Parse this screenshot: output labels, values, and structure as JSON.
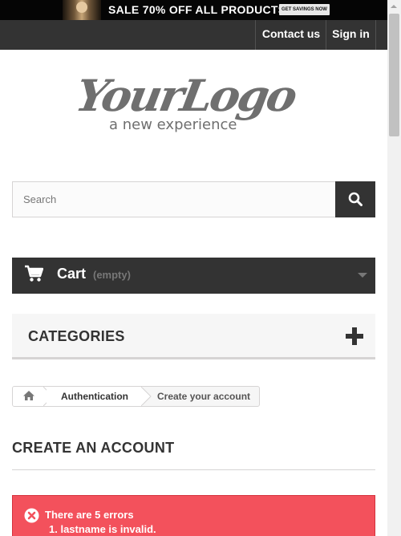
{
  "promo": {
    "text": "SALE 70% OFF ALL PRODUCTS",
    "button_label": "GET SAVINGS NOW"
  },
  "nav": {
    "contact_label": "Contact us",
    "signin_label": "Sign in"
  },
  "logo": {
    "wordmark": "YourLogo",
    "tagline": "a new experience"
  },
  "search": {
    "placeholder": "Search",
    "value": "",
    "button_icon": "search-icon"
  },
  "cart": {
    "label": "Cart",
    "status": "(empty)",
    "icon": "shopping-cart-icon"
  },
  "categories": {
    "title": "CATEGORIES",
    "icon": "plus-icon"
  },
  "breadcrumb": {
    "home_icon": "home-icon",
    "items": [
      {
        "label": "Authentication"
      },
      {
        "label": "Create your account"
      }
    ]
  },
  "page_heading": "CREATE AN ACCOUNT",
  "alert": {
    "title": "There are 5 errors",
    "errors": [
      "1. lastname is invalid."
    ],
    "icon": "close-circle-icon"
  },
  "colors": {
    "dark_bar": "#333333",
    "error_red": "#f3515c",
    "border_gray": "#d6d4d4",
    "panel_gray": "#f6f6f6"
  }
}
